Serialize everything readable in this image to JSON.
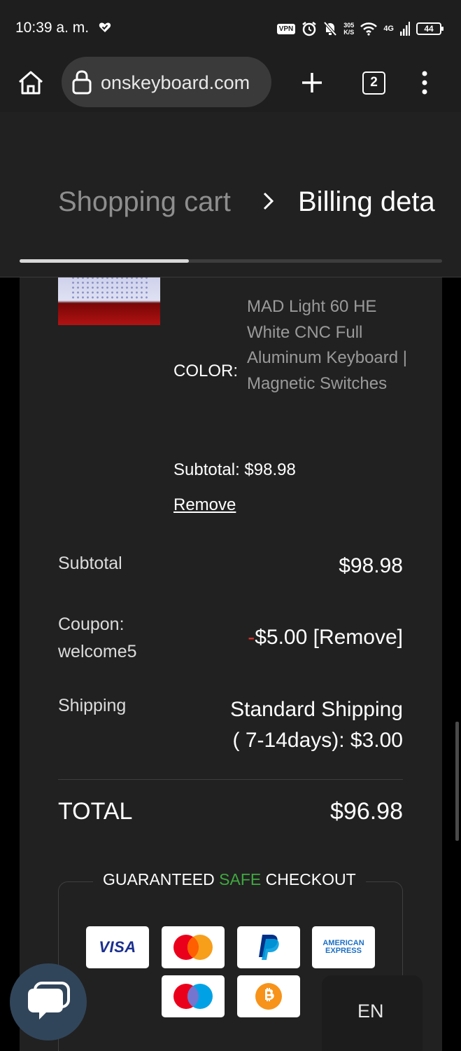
{
  "status_bar": {
    "time": "10:39 a. m.",
    "vpn": "VPN",
    "speed_value": "305",
    "speed_unit": "K/S",
    "network": "4G",
    "battery": "44"
  },
  "browser": {
    "url": "onskeyboard.com",
    "tab_count": "2",
    "icons": [
      "home-icon",
      "lock-icon",
      "plus-icon",
      "tabs-icon",
      "more-vert-icon"
    ]
  },
  "checkout_steps": {
    "previous": "Shopping cart",
    "current": "Billing deta",
    "progress_fraction": 0.4
  },
  "cart_item": {
    "color_label": "COLOR:",
    "color_value": "MAD Light 60 HE White CNC Full Aluminum Keyboard | Magnetic Switches",
    "subtotal": "Subtotal: $98.98",
    "remove": "Remove"
  },
  "summary": {
    "subtotal_label": "Subtotal",
    "subtotal_value": "$98.98",
    "coupon_label_1": "Coupon:",
    "coupon_label_2": "welcome5",
    "coupon_minus": "-",
    "coupon_value": "$5.00 [Remove]",
    "shipping_label": "Shipping",
    "shipping_value_1": "Standard Shipping",
    "shipping_value_2": "( 7-14days): $3.00",
    "total_label": "TOTAL",
    "total_value": "$96.98"
  },
  "safe_checkout": {
    "part1": "GUARANTEED ",
    "part2": "SAFE",
    "part3": " CHECKOUT",
    "payment_methods": [
      "VISA",
      "Mastercard",
      "PayPal",
      "AMERICAN",
      "EXPRESS",
      "Maestro",
      "Bitcoin"
    ]
  },
  "language": "EN",
  "colors": {
    "background": "#212121",
    "safe_green": "#3fa83f",
    "discount_red": "#e0322a"
  }
}
